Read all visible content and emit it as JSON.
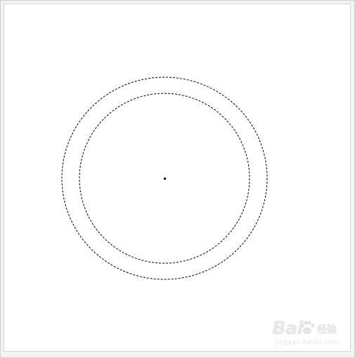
{
  "canvas": {
    "background": "#ffffff",
    "frame_color": "#f4f4f4"
  },
  "selection": {
    "shape": "ring",
    "style": "marching-ants",
    "stroke_color": "#000000",
    "center_marker": "dot"
  },
  "watermark": {
    "brand": "Bai",
    "paw_icon": "paw-icon",
    "cn": "经验",
    "url": "jingyan.baidu.com"
  }
}
